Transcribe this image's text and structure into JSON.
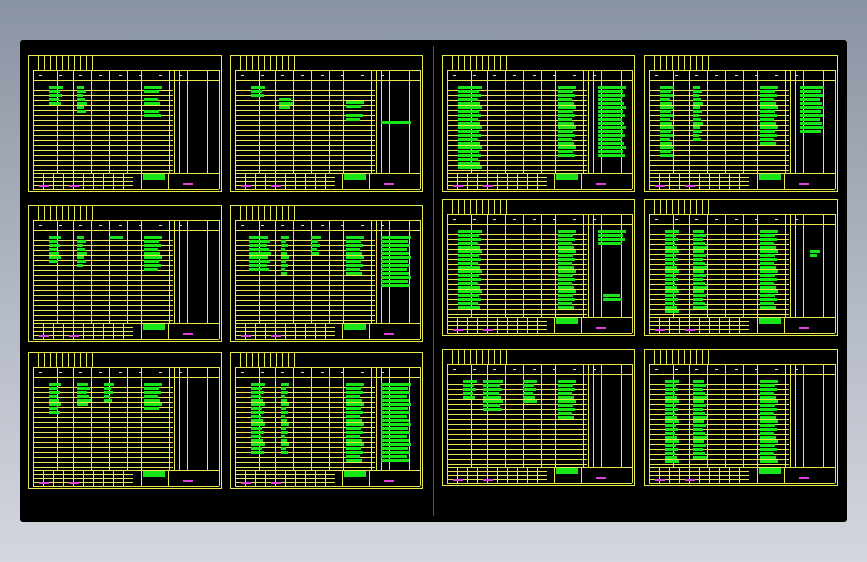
{
  "viewport": {
    "background": "#000000"
  },
  "colors": {
    "frame": "#e8e850",
    "text_green": "#19e619",
    "text_magenta": "#e040e0",
    "divider": "#d02020"
  },
  "sheets": [
    {
      "id": "1",
      "column": "left-1",
      "row": 1
    },
    {
      "id": "2",
      "column": "left-2",
      "row": 1
    },
    {
      "id": "3",
      "column": "left-1",
      "row": 2
    },
    {
      "id": "4",
      "column": "left-2",
      "row": 2
    },
    {
      "id": "5",
      "column": "left-1",
      "row": 3
    },
    {
      "id": "6",
      "column": "left-2",
      "row": 3
    },
    {
      "id": "7",
      "column": "right-1",
      "row": 1
    },
    {
      "id": "8",
      "column": "right-2",
      "row": 1
    },
    {
      "id": "9",
      "column": "right-1",
      "row": 2
    },
    {
      "id": "10",
      "column": "right-2",
      "row": 2
    },
    {
      "id": "11",
      "column": "right-1",
      "row": 3
    },
    {
      "id": "12",
      "column": "right-2",
      "row": 3
    }
  ]
}
